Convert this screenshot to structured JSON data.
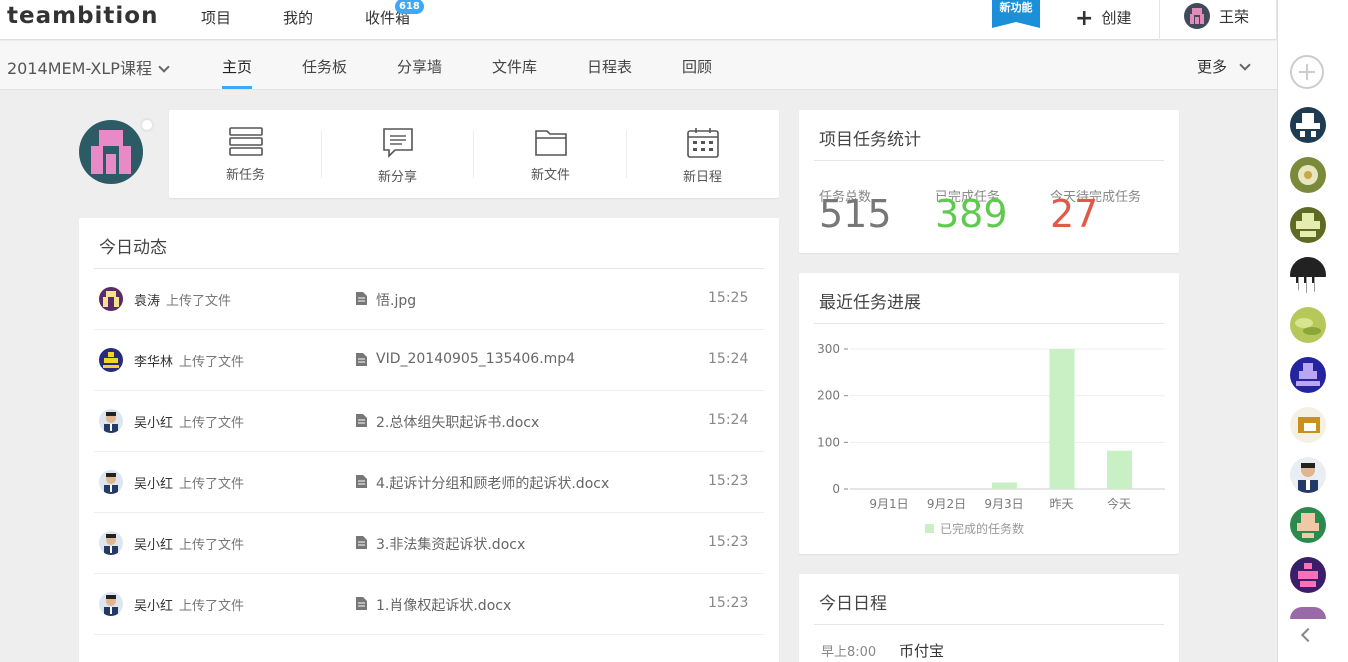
{
  "header": {
    "logo": "teambition",
    "nav": [
      "项目",
      "我的",
      "收件箱"
    ],
    "inbox_badge": "618",
    "new_feature": "新功能",
    "create_label": "创建",
    "user_name": "王荣"
  },
  "subnav": {
    "project": "2014MEM-XLP课程",
    "tabs": [
      "主页",
      "任务板",
      "分享墙",
      "文件库",
      "日程表",
      "回顾"
    ],
    "more": "更多"
  },
  "quick_actions": [
    "新任务",
    "新分享",
    "新文件",
    "新日程"
  ],
  "activity": {
    "title": "今日动态",
    "rows": [
      {
        "user": "袁涛",
        "verb": "上传了文件",
        "file": "悟.jpg",
        "time": "15:25",
        "avatar": "pixel-purple"
      },
      {
        "user": "李华林",
        "verb": "上传了文件",
        "file": "VID_20140905_135406.mp4",
        "time": "15:24",
        "avatar": "pixel-yellow"
      },
      {
        "user": "吴小红",
        "verb": "上传了文件",
        "file": "2.总体组失职起诉书.docx",
        "time": "15:24",
        "avatar": "photo"
      },
      {
        "user": "吴小红",
        "verb": "上传了文件",
        "file": "4.起诉计分组和顾老师的起诉状.docx",
        "time": "15:23",
        "avatar": "photo"
      },
      {
        "user": "吴小红",
        "verb": "上传了文件",
        "file": "3.非法集资起诉状.docx",
        "time": "15:23",
        "avatar": "photo"
      },
      {
        "user": "吴小红",
        "verb": "上传了文件",
        "file": "1.肖像权起诉状.docx",
        "time": "15:23",
        "avatar": "photo"
      }
    ]
  },
  "stats": {
    "title": "项目任务统计",
    "items": [
      {
        "label": "任务总数",
        "value": "515",
        "color": "#777777"
      },
      {
        "label": "已完成任务",
        "value": "389",
        "color": "#5ecb4e"
      },
      {
        "label": "今天待完成任务",
        "value": "27",
        "color": "#e05a4a"
      }
    ]
  },
  "progress": {
    "title": "最近任务进展"
  },
  "chart_data": {
    "type": "bar",
    "categories": [
      "9月1日",
      "9月2日",
      "9月3日",
      "昨天",
      "今天"
    ],
    "series": [
      {
        "name": "已完成的任务数",
        "values": [
          0,
          0,
          14,
          300,
          82
        ],
        "color": "#c8f0c4"
      }
    ],
    "yticks": [
      0,
      100,
      200,
      300
    ],
    "ylim": [
      0,
      300
    ],
    "grid": true,
    "legend": "bottom"
  },
  "schedule": {
    "title": "今日日程",
    "time": "早上8:00",
    "event": "币付宝"
  }
}
